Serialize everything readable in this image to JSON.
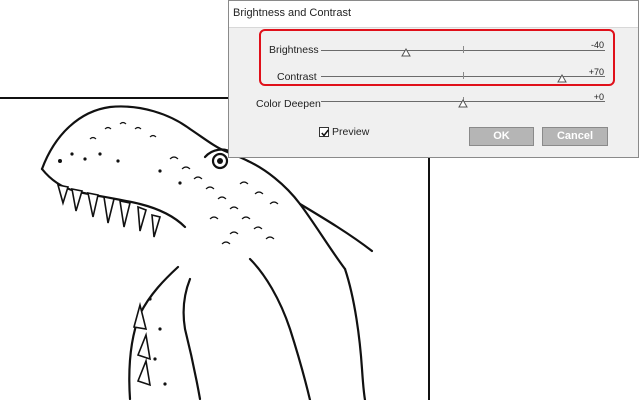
{
  "dialog": {
    "title": "Brightness and Contrast",
    "sliders": [
      {
        "label": "Brightness",
        "value_text": "-40",
        "value": -40,
        "min": -100,
        "max": 100
      },
      {
        "label": "Contrast",
        "value_text": "+70",
        "value": 70,
        "min": -100,
        "max": 100
      },
      {
        "label": "Color Deepen",
        "value_text": "+0",
        "value": 0,
        "min": -100,
        "max": 100
      }
    ],
    "preview": {
      "label": "Preview",
      "checked": true
    },
    "ok_label": "OK",
    "cancel_label": "Cancel",
    "highlight_color": "#e0101a"
  },
  "artwork": {
    "subject": "dinosaur-line-drawing"
  }
}
